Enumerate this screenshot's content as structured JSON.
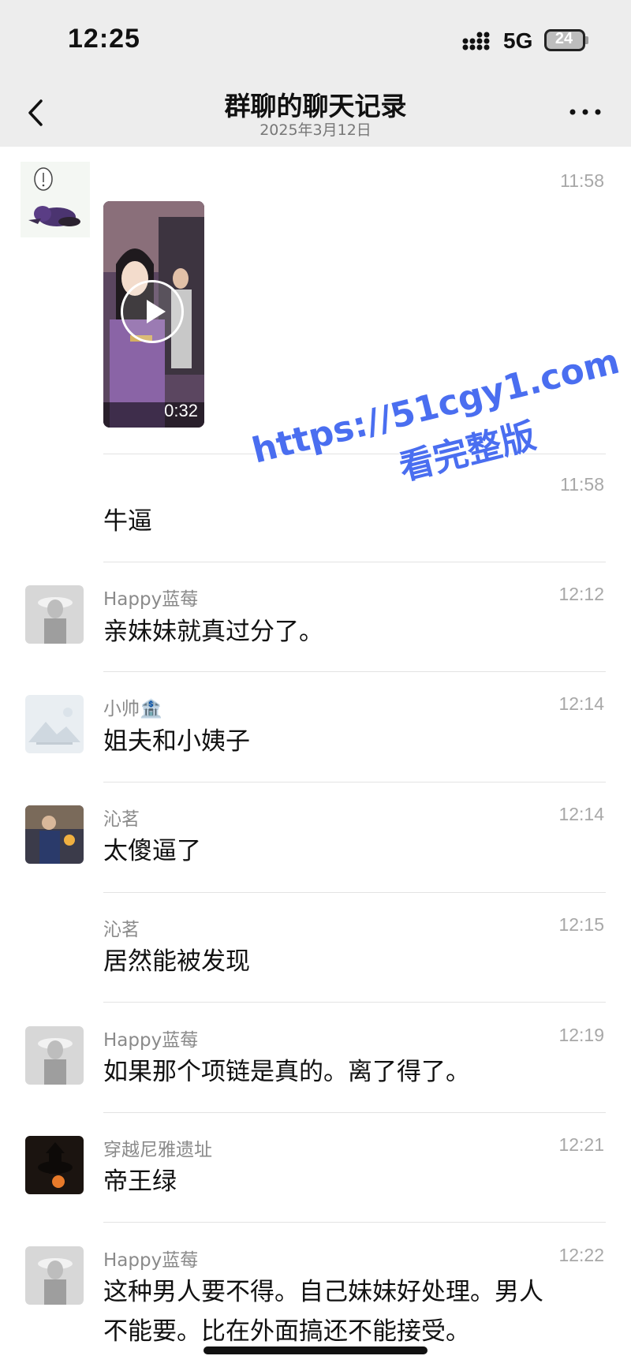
{
  "status_bar": {
    "time": "12:25",
    "network": "5G",
    "battery": "24"
  },
  "nav": {
    "title": "群聊的聊天记录",
    "subtitle": "2025年3月12日"
  },
  "messages": [
    {
      "sender": "",
      "time": "11:58",
      "type": "video",
      "video_duration": "0:32"
    },
    {
      "sender": "",
      "time": "11:58",
      "text": "牛逼"
    },
    {
      "sender": "Happy蓝莓",
      "time": "12:12",
      "text": "亲妹妹就真过分了。"
    },
    {
      "sender": "小帅🏦",
      "time": "12:14",
      "text": "姐夫和小姨子"
    },
    {
      "sender": "沁茗",
      "time": "12:14",
      "text": "太傻逼了"
    },
    {
      "sender": "沁茗",
      "time": "12:15",
      "text": "居然能被发现"
    },
    {
      "sender": "Happy蓝莓",
      "time": "12:19",
      "text": "如果那个项链是真的。离了得了。"
    },
    {
      "sender": "穿越尼雅遗址",
      "time": "12:21",
      "text": "帝王绿"
    },
    {
      "sender": "Happy蓝莓",
      "time": "12:22",
      "text_line1": "这种男人要不得。自己妹妹好处理。男人",
      "text_line2": "不能要。比在外面搞还不能接受。"
    }
  ],
  "watermark": {
    "line1": "https://51cgy1.com",
    "line2": "看完整版"
  },
  "colors": {
    "header_bg": "#ededed",
    "watermark": "#4a6ef0"
  }
}
